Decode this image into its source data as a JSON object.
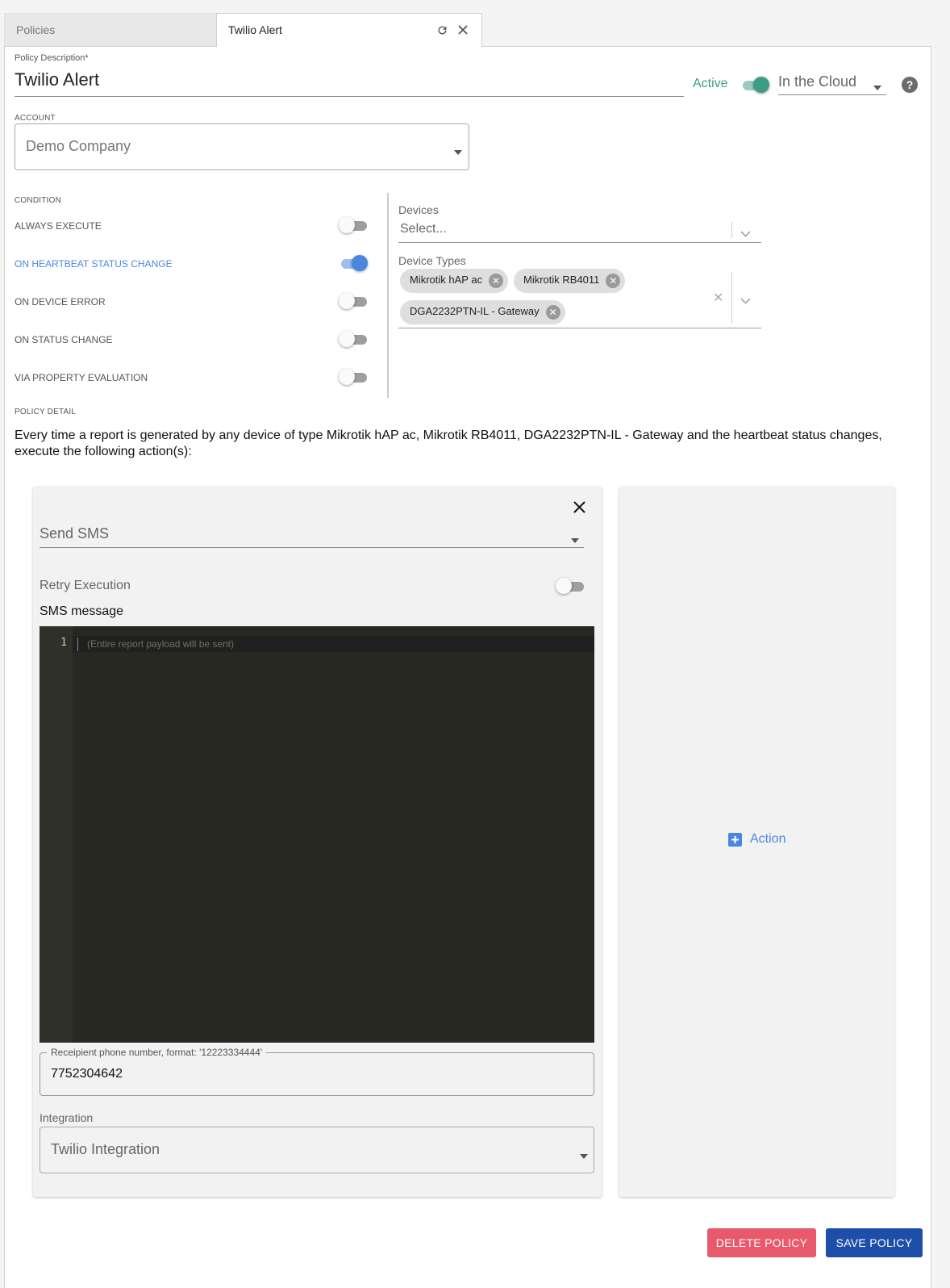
{
  "tabs": [
    {
      "label": "Policies"
    },
    {
      "label": "Twilio Alert"
    }
  ],
  "policy": {
    "description_label": "Policy Description*",
    "description_value": "Twilio Alert",
    "active_label": "Active",
    "active": true,
    "location_value": "In the Cloud"
  },
  "account": {
    "label": "ACCOUNT",
    "value": "Demo Company"
  },
  "condition": {
    "label": "CONDITION",
    "items": [
      {
        "label": "ALWAYS EXECUTE",
        "enabled": false
      },
      {
        "label": "ON HEARTBEAT STATUS CHANGE",
        "enabled": true
      },
      {
        "label": "ON DEVICE ERROR",
        "enabled": false
      },
      {
        "label": "ON STATUS CHANGE",
        "enabled": false
      },
      {
        "label": "VIA PROPERTY EVALUATION",
        "enabled": false
      }
    ]
  },
  "devices": {
    "label": "Devices",
    "placeholder": "Select..."
  },
  "device_types": {
    "label": "Device Types",
    "chips": [
      "Mikrotik hAP ac",
      "Mikrotik RB4011",
      "DGA2232PTN-IL - Gateway"
    ]
  },
  "policy_detail": {
    "label": "POLICY DETAIL",
    "text": "Every time a report is generated by any device of type Mikrotik hAP ac, Mikrotik RB4011, DGA2232PTN-IL - Gateway and the heartbeat status changes, execute the following action(s):"
  },
  "action": {
    "type_value": "Send SMS",
    "retry_label": "Retry Execution",
    "retry_enabled": false,
    "sms_label": "SMS message",
    "editor_line_number": "1",
    "editor_placeholder": "(Entire report payload will be sent)",
    "phone_label": "Receipient phone number, format: '12223334444'",
    "phone_value": "7752304642",
    "integration_label": "Integration",
    "integration_value": "Twilio Integration"
  },
  "add_action_label": "Action",
  "buttons": {
    "delete": "DELETE POLICY",
    "save": "SAVE POLICY"
  },
  "colors": {
    "teal": "#3d9c86",
    "blue": "#4a86e0",
    "delete": "#e85a6b",
    "save": "#1e4fa8",
    "editor_bg": "#272822"
  }
}
